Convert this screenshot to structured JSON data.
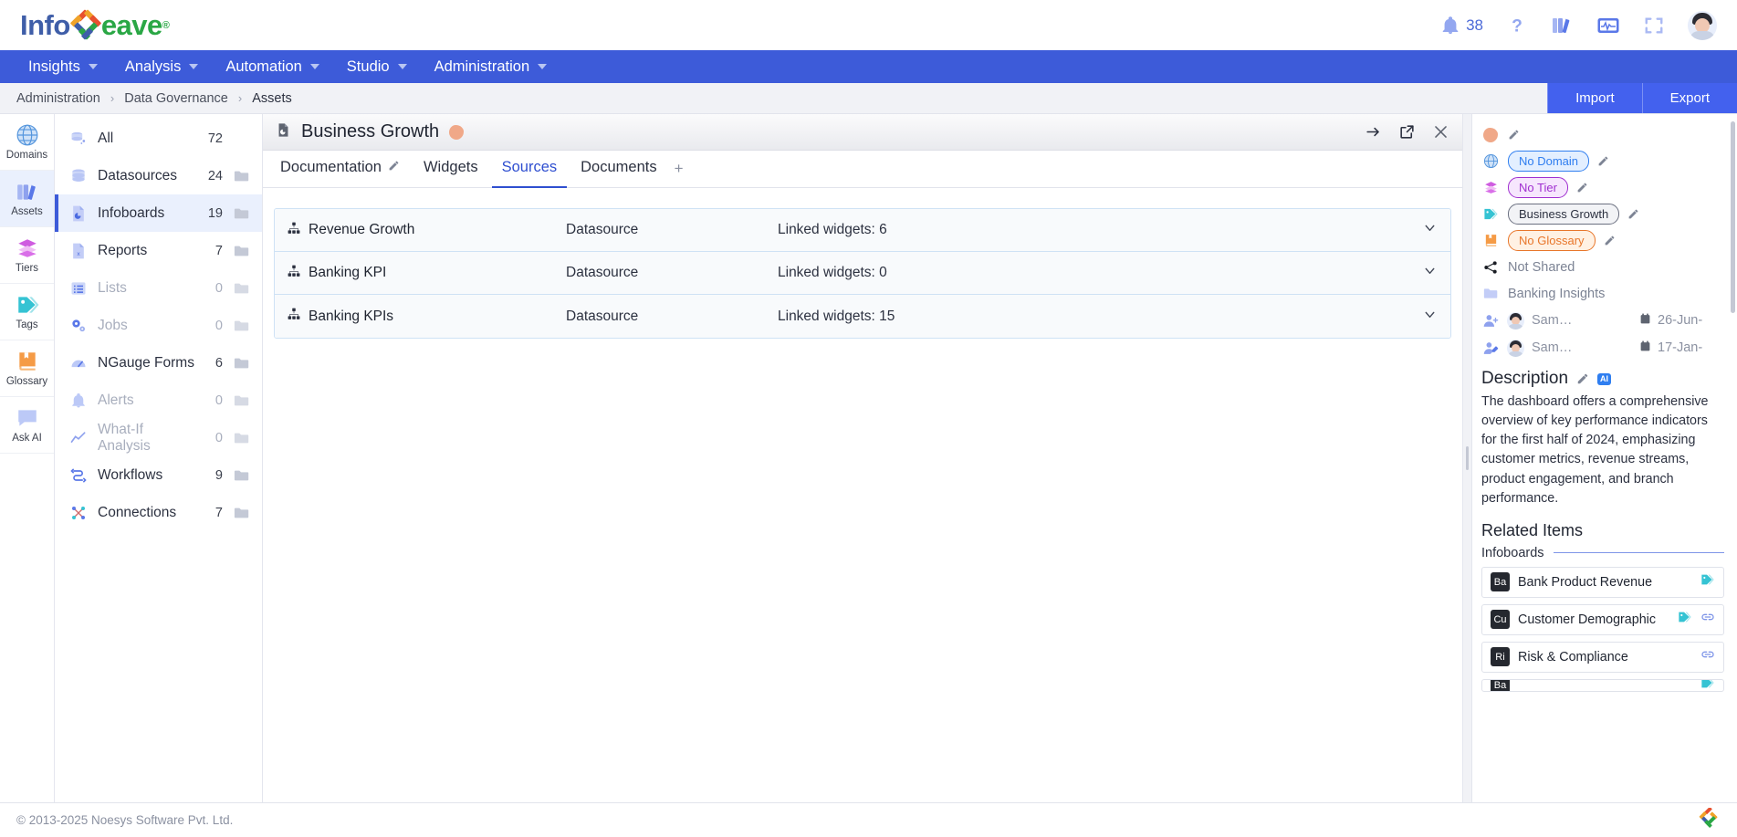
{
  "app": {
    "logo_part1": "Info",
    "logo_part2": "eave",
    "logo_reg": "®"
  },
  "topbar": {
    "notification_count": "38",
    "icons": [
      "bell-icon",
      "help-icon",
      "library-icon",
      "monitor-pulse-icon",
      "fullscreen-icon",
      "user-avatar"
    ]
  },
  "menubar": {
    "items": [
      {
        "label": "Insights"
      },
      {
        "label": "Analysis"
      },
      {
        "label": "Automation"
      },
      {
        "label": "Studio"
      },
      {
        "label": "Administration"
      }
    ]
  },
  "breadcrumb": {
    "items": [
      "Administration",
      "Data Governance",
      "Assets"
    ],
    "separator": "›",
    "import_label": "Import",
    "export_label": "Export"
  },
  "rail": {
    "items": [
      {
        "label": "Domains",
        "icon": "globe-icon"
      },
      {
        "label": "Assets",
        "icon": "books-icon"
      },
      {
        "label": "Tiers",
        "icon": "layers-icon"
      },
      {
        "label": "Tags",
        "icon": "tag-icon"
      },
      {
        "label": "Glossary",
        "icon": "book-icon"
      },
      {
        "label": "Ask AI",
        "icon": "chat-bubble-icon"
      }
    ]
  },
  "assetlist": {
    "items": [
      {
        "label": "All",
        "count": "72",
        "icon": "database-all-icon",
        "dim": false,
        "folder": false
      },
      {
        "label": "Datasources",
        "count": "24",
        "icon": "database-icon",
        "dim": false,
        "folder": true
      },
      {
        "label": "Infoboards",
        "count": "19",
        "icon": "infoboard-icon",
        "dim": false,
        "folder": true
      },
      {
        "label": "Reports",
        "count": "7",
        "icon": "report-icon",
        "dim": false,
        "folder": true
      },
      {
        "label": "Lists",
        "count": "0",
        "icon": "list-icon",
        "dim": true,
        "folder": true
      },
      {
        "label": "Jobs",
        "count": "0",
        "icon": "jobs-icon",
        "dim": true,
        "folder": true
      },
      {
        "label": "NGauge Forms",
        "count": "6",
        "icon": "ngauge-icon",
        "dim": false,
        "folder": true
      },
      {
        "label": "Alerts",
        "count": "0",
        "icon": "alert-icon",
        "dim": true,
        "folder": true
      },
      {
        "label": "What-If Analysis",
        "count": "0",
        "icon": "whatif-icon",
        "dim": true,
        "folder": true
      },
      {
        "label": "Workflows",
        "count": "9",
        "icon": "workflow-icon",
        "dim": false,
        "folder": true
      },
      {
        "label": "Connections",
        "count": "7",
        "icon": "connection-icon",
        "dim": false,
        "folder": true
      }
    ]
  },
  "panel": {
    "title": "Business Growth",
    "tabs": [
      {
        "label": "Documentation",
        "editable": true,
        "active": false
      },
      {
        "label": "Widgets",
        "editable": false,
        "active": false
      },
      {
        "label": "Sources",
        "editable": false,
        "active": true
      },
      {
        "label": "Documents",
        "editable": false,
        "active": false
      }
    ],
    "tab_add": "+",
    "sources": [
      {
        "name": "Revenue Growth",
        "type": "Datasource",
        "linked": "Linked widgets: 6"
      },
      {
        "name": "Banking KPI",
        "type": "Datasource",
        "linked": "Linked widgets: 0"
      },
      {
        "name": "Banking KPIs",
        "type": "Datasource",
        "linked": "Linked widgets: 15"
      }
    ]
  },
  "details": {
    "meta": [
      {
        "icon": "blob-icon",
        "pill": null,
        "pill_color": null,
        "text": null
      },
      {
        "icon": "globe-icon",
        "pill": "No Domain",
        "pill_color": "#2f7ef0",
        "pill_bg": "#e3efff",
        "text": null
      },
      {
        "icon": "layers-icon",
        "pill": "No Tier",
        "pill_color": "#a02fd0",
        "pill_bg": "#f6e6fd",
        "text": null
      },
      {
        "icon": "tag-icon",
        "pill": "Business Growth",
        "pill_color": "#2c3140",
        "pill_bg": "#f2f3f6",
        "text": null
      },
      {
        "icon": "book-icon",
        "pill": "No Glossary",
        "pill_color": "#e8762a",
        "pill_bg": "#fff1e3",
        "text": null
      },
      {
        "icon": "share-icon",
        "pill": null,
        "pill_color": null,
        "text": "Not Shared"
      },
      {
        "icon": "folder-icon",
        "pill": null,
        "pill_color": null,
        "text": "Banking Insights"
      }
    ],
    "people": [
      {
        "icon": "user-add-icon",
        "name": "Sam…",
        "date": "26-Jun-"
      },
      {
        "icon": "user-edit-icon",
        "name": "Sam…",
        "date": "17-Jan-"
      }
    ],
    "description_title": "Description",
    "ai_chip": "AI",
    "description": "The dashboard offers a comprehensive overview of key performance indicators for the first half of 2024, emphasizing customer metrics, revenue streams, product engagement, and branch performance.",
    "related_title": "Related Items",
    "related_group": "Infoboards",
    "related": [
      {
        "initials": "Ba",
        "name": "Bank Product Revenue",
        "has_tag": true,
        "has_link": false
      },
      {
        "initials": "Cu",
        "name": "Customer Demographic",
        "has_tag": true,
        "has_link": true
      },
      {
        "initials": "Ri",
        "name": "Risk & Compliance",
        "has_tag": false,
        "has_link": true
      },
      {
        "initials": "Ba",
        "name": "",
        "has_tag": true,
        "has_link": false
      }
    ]
  },
  "footer": {
    "copyright": "© 2013-2025 Noesys Software Pvt. Ltd."
  }
}
